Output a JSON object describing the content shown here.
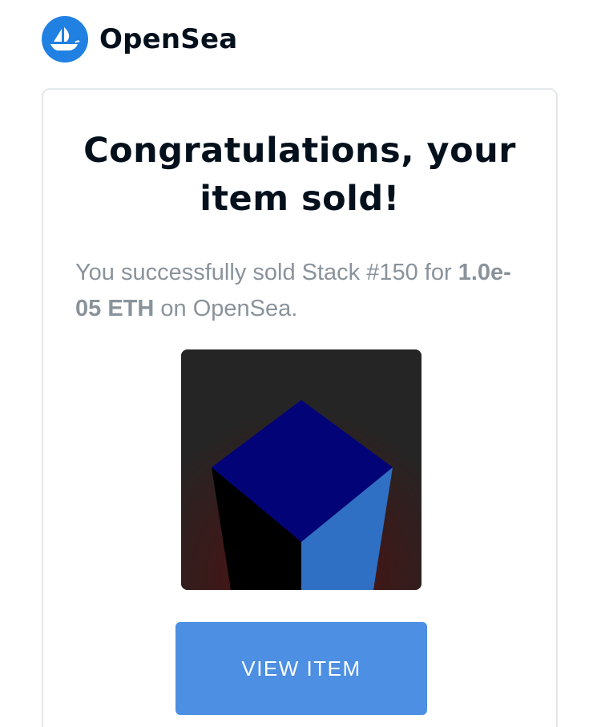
{
  "header": {
    "brand": "OpenSea",
    "logo_icon": "opensea-ship-icon"
  },
  "card": {
    "title": "Congratulations, your item sold!",
    "message_prefix": "You successfully sold Stack #150 for ",
    "message_amount": "1.0e-05 ETH",
    "message_suffix": " on OpenSea.",
    "button_label": "VIEW ITEM"
  },
  "colors": {
    "brand_blue": "#2081e2",
    "button_blue": "#4d8fe2",
    "cube_top": "#030378",
    "cube_right": "#2f6fc4",
    "cube_left": "#000000",
    "image_bg": "#252525"
  }
}
